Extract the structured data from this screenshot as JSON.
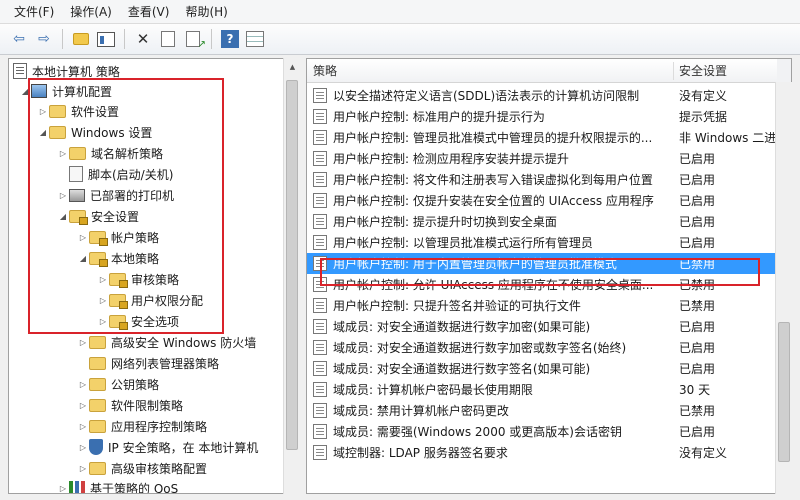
{
  "menu": [
    "文件(F)",
    "操作(A)",
    "查看(V)",
    "帮助(H)"
  ],
  "toolbar": {
    "back_icon": "back-arrow-icon",
    "forward_icon": "forward-arrow-icon",
    "back_glyph": "⇦",
    "forward_glyph": "⇨",
    "delete_glyph": "✕",
    "help_glyph": "?"
  },
  "tree": {
    "root": "本地计算机 策略",
    "computer_config": "计算机配置",
    "software_settings": "软件设置",
    "windows_settings": "Windows 设置",
    "dns_policy": "域名解析策略",
    "scripts": "脚本(启动/关机)",
    "deployed_printers": "已部署的打印机",
    "security_settings": "安全设置",
    "account_policy": "帐户策略",
    "local_policy": "本地策略",
    "audit_policy": "审核策略",
    "user_rights": "用户权限分配",
    "security_options": "安全选项",
    "advanced_firewall": "高级安全 Windows 防火墙",
    "network_list": "网络列表管理器策略",
    "public_key": "公钥策略",
    "software_restriction": "软件限制策略",
    "app_control": "应用程序控制策略",
    "ipsec": "IP 安全策略，在 本地计算机",
    "advanced_audit": "高级审核策略配置",
    "qos": "基于策略的 QoS"
  },
  "list": {
    "header_policy": "策略",
    "header_setting": "安全设置",
    "rows": [
      {
        "policy": "以安全描述符定义语言(SDDL)语法表示的计算机访问限制",
        "setting": "没有定义"
      },
      {
        "policy": "用户帐户控制: 标准用户的提升提示行为",
        "setting": "提示凭据"
      },
      {
        "policy": "用户帐户控制: 管理员批准模式中管理员的提升权限提示的...",
        "setting": "非 Windows 二进"
      },
      {
        "policy": "用户帐户控制: 检测应用程序安装并提示提升",
        "setting": "已启用"
      },
      {
        "policy": "用户帐户控制: 将文件和注册表写入错误虚拟化到每用户位置",
        "setting": "已启用"
      },
      {
        "policy": "用户帐户控制: 仅提升安装在安全位置的 UIAccess 应用程序",
        "setting": "已启用"
      },
      {
        "policy": "用户帐户控制: 提示提升时切换到安全桌面",
        "setting": "已启用"
      },
      {
        "policy": "用户帐户控制: 以管理员批准模式运行所有管理员",
        "setting": "已启用"
      },
      {
        "policy": "用户帐户控制: 用于内置管理员帐户的管理员批准模式",
        "setting": "已禁用"
      },
      {
        "policy": "用户帐户控制: 允许 UIAccess 应用程序在不使用安全桌面...",
        "setting": "已禁用"
      },
      {
        "policy": "用户帐户控制: 只提升签名并验证的可执行文件",
        "setting": "已禁用"
      },
      {
        "policy": "域成员: 对安全通道数据进行数字加密(如果可能)",
        "setting": "已启用"
      },
      {
        "policy": "域成员: 对安全通道数据进行数字加密或数字签名(始终)",
        "setting": "已启用"
      },
      {
        "policy": "域成员: 对安全通道数据进行数字签名(如果可能)",
        "setting": "已启用"
      },
      {
        "policy": "域成员: 计算机帐户密码最长使用期限",
        "setting": "30 天"
      },
      {
        "policy": "域成员: 禁用计算机帐户密码更改",
        "setting": "已禁用"
      },
      {
        "policy": "域成员: 需要强(Windows 2000 或更高版本)会话密钥",
        "setting": "已启用"
      },
      {
        "policy": "域控制器: LDAP 服务器签名要求",
        "setting": "没有定义"
      }
    ]
  },
  "colors": {
    "selection": "#3399ff",
    "highlight_box": "#d9232a"
  }
}
